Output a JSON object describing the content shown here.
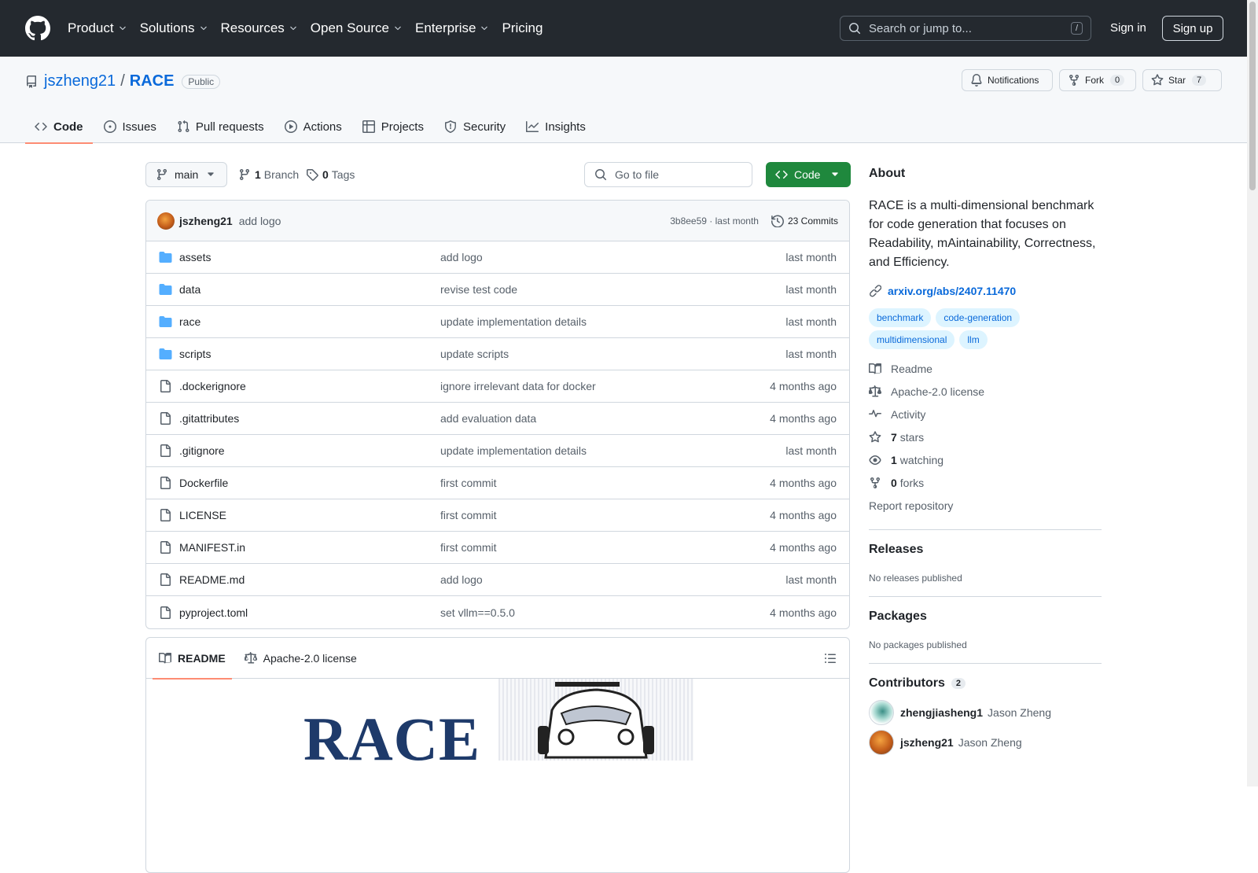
{
  "header": {
    "nav": [
      "Product",
      "Solutions",
      "Resources",
      "Open Source",
      "Enterprise",
      "Pricing"
    ],
    "search_placeholder": "Search or jump to...",
    "search_key": "/",
    "signin": "Sign in",
    "signup": "Sign up"
  },
  "repo": {
    "owner": "jszheng21",
    "name": "RACE",
    "visibility": "Public",
    "notifications": "Notifications",
    "fork_label": "Fork",
    "fork_count": "0",
    "star_label": "Star",
    "star_count": "7",
    "tabs": [
      "Code",
      "Issues",
      "Pull requests",
      "Actions",
      "Projects",
      "Security",
      "Insights"
    ]
  },
  "branchbar": {
    "branch": "main",
    "branch_count": "1",
    "branch_label": "Branch",
    "tag_count": "0",
    "tag_label": "Tags",
    "gofile_placeholder": "Go to file",
    "code_label": "Code"
  },
  "commit": {
    "author": "jszheng21",
    "message": "add logo",
    "hash": "3b8ee59",
    "time": "last month",
    "commits_label": "23 Commits"
  },
  "files": [
    {
      "name": "assets",
      "type": "dir",
      "msg": "add logo",
      "date": "last month"
    },
    {
      "name": "data",
      "type": "dir",
      "msg": "revise test code",
      "date": "last month"
    },
    {
      "name": "race",
      "type": "dir",
      "msg": "update implementation details",
      "date": "last month"
    },
    {
      "name": "scripts",
      "type": "dir",
      "msg": "update scripts",
      "date": "last month"
    },
    {
      "name": ".dockerignore",
      "type": "file",
      "msg": "ignore irrelevant data for docker",
      "date": "4 months ago"
    },
    {
      "name": ".gitattributes",
      "type": "file",
      "msg": "add evaluation data",
      "date": "4 months ago"
    },
    {
      "name": ".gitignore",
      "type": "file",
      "msg": "update implementation details",
      "date": "last month"
    },
    {
      "name": "Dockerfile",
      "type": "file",
      "msg": "first commit",
      "date": "4 months ago"
    },
    {
      "name": "LICENSE",
      "type": "file",
      "msg": "first commit",
      "date": "4 months ago"
    },
    {
      "name": "MANIFEST.in",
      "type": "file",
      "msg": "first commit",
      "date": "4 months ago"
    },
    {
      "name": "README.md",
      "type": "file",
      "msg": "add logo",
      "date": "last month"
    },
    {
      "name": "pyproject.toml",
      "type": "file",
      "msg": "set vllm==0.5.0",
      "date": "4 months ago"
    }
  ],
  "readme": {
    "tab_readme": "README",
    "tab_license": "Apache-2.0 license",
    "logo_text": "RACE"
  },
  "about": {
    "title": "About",
    "description": "RACE is a multi-dimensional benchmark for code generation that focuses on Readability, mAintainability, Correctness, and Efficiency.",
    "link": "arxiv.org/abs/2407.11470",
    "topics": [
      "benchmark",
      "code-generation",
      "multidimensional",
      "llm"
    ],
    "readme": "Readme",
    "license": "Apache-2.0 license",
    "activity": "Activity",
    "stars_count": "7",
    "stars_label": "stars",
    "watching_count": "1",
    "watching_label": "watching",
    "forks_count": "0",
    "forks_label": "forks",
    "report": "Report repository",
    "releases_title": "Releases",
    "releases_none": "No releases published",
    "packages_title": "Packages",
    "packages_none": "No packages published",
    "contributors_title": "Contributors",
    "contributors_count": "2",
    "contributors": [
      {
        "login": "zhengjiasheng1",
        "name": "Jason Zheng"
      },
      {
        "login": "jszheng21",
        "name": "Jason Zheng"
      }
    ]
  }
}
